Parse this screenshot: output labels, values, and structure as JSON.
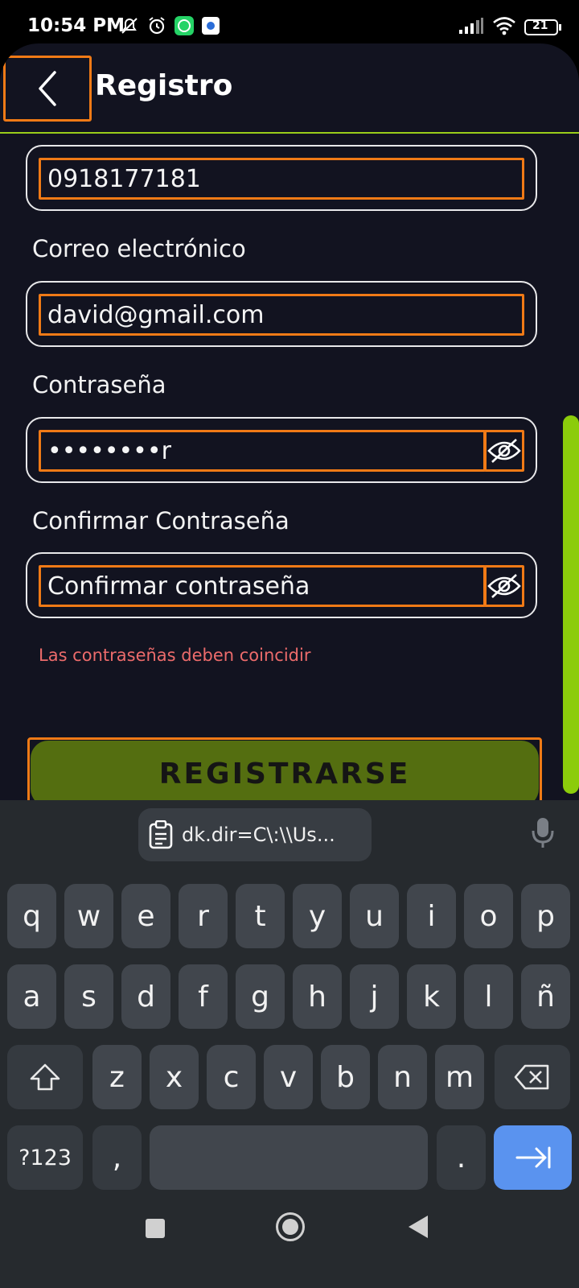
{
  "status": {
    "time": "10:54 PM",
    "battery": "21"
  },
  "header": {
    "title": "Registro"
  },
  "form": {
    "phone_value": "0918177181",
    "email_label": "Correo electrónico",
    "email_value": "david@gmail.com",
    "password_label": "Contraseña",
    "password_value": "••••••••r",
    "confirm_label": "Confirmar Contraseña",
    "confirm_placeholder": "Confirmar contraseña",
    "error": "Las contraseñas deben coincidir",
    "submit_label": "REGISTRARSE"
  },
  "keyboard": {
    "clipboard_text": "dk.dir=C\\:\\\\Us...",
    "row1": [
      "q",
      "w",
      "e",
      "r",
      "t",
      "y",
      "u",
      "i",
      "o",
      "p"
    ],
    "row2": [
      "a",
      "s",
      "d",
      "f",
      "g",
      "h",
      "j",
      "k",
      "l",
      "ñ"
    ],
    "row3": [
      "z",
      "x",
      "c",
      "v",
      "b",
      "n",
      "m"
    ],
    "symbols_label": "?123",
    "comma": ",",
    "period": "."
  },
  "colors": {
    "accent": "#8ccc0b",
    "button": "#546e10",
    "error": "#ec6b6b",
    "highlight": "#f07a16",
    "background": "#121320",
    "enter_key": "#5a93ef"
  }
}
